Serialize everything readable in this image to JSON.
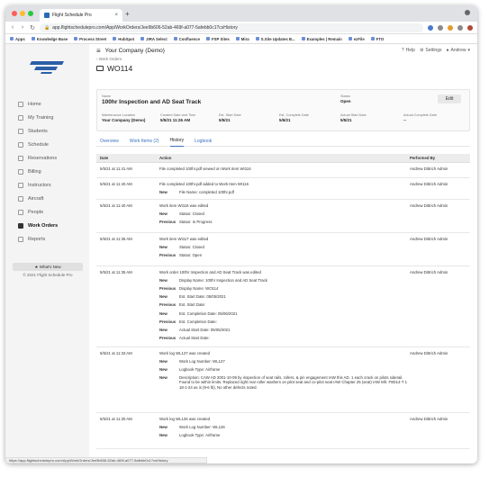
{
  "browser": {
    "tab_title": "Flight Schedule Pro",
    "url": "app.flightschedulepro.com/App/WorkOrders/Jee9b606-52ab-469f-a077-5afebb0c1?csHistory",
    "bookmarks": [
      "Apps",
      "Knowledge Base",
      "Process Street",
      "HubSpot",
      "JIRA Select",
      "Confluence",
      "FSP Sites",
      "Mira",
      "S.Site Updates B...",
      "Examples | Remain",
      "ezFile",
      "FTO"
    ]
  },
  "app": {
    "org_name": "Your Company (Demo)",
    "help": "Help",
    "settings": "Settings",
    "user": "Andrew"
  },
  "sidebar": {
    "items": [
      {
        "label": "Home"
      },
      {
        "label": "My Training"
      },
      {
        "label": "Students"
      },
      {
        "label": "Schedule"
      },
      {
        "label": "Reservations"
      },
      {
        "label": "Billing"
      },
      {
        "label": "Instructors"
      },
      {
        "label": "Aircraft"
      },
      {
        "label": "People"
      },
      {
        "label": "Work Orders"
      },
      {
        "label": "Reports"
      }
    ],
    "whats_new": "★ What's New",
    "copyright": "© 2021 Flight Schedule Pro"
  },
  "page": {
    "breadcrumb": "‹ Work Orders",
    "title": "WO114"
  },
  "card": {
    "name_label": "Name",
    "name_value": "100hr Inspection and AD Seat Track",
    "status_label": "Status",
    "status_value": "Open",
    "edit_label": "Edit",
    "fields": [
      {
        "label": "Maintenance Location",
        "value": "Your Company (Demo)"
      },
      {
        "label": "Created Date and Time",
        "value": "5/5/21 11:26 AM"
      },
      {
        "label": "Est. Start Date",
        "value": "5/5/21"
      },
      {
        "label": "Est. Complete Date",
        "value": "5/6/21"
      },
      {
        "label": "Actual Start Date",
        "value": "5/5/21"
      },
      {
        "label": "Actual Complete Date",
        "value": "--"
      }
    ]
  },
  "tabs": [
    "Overview",
    "Work Items (2)",
    "History",
    "Logbook"
  ],
  "history": {
    "headers": {
      "date": "Date",
      "action": "Action",
      "by": "Performed By"
    },
    "rows": [
      {
        "date": "5/5/21 at 11:41 AM",
        "action": "File completed 100hr.pdf viewed on Work Item WI116",
        "by": "Andrew Dittrich Admin",
        "subs": []
      },
      {
        "date": "5/5/21 at 11:40 AM",
        "action": "File completed 100hr.pdf added to Work Item WI116",
        "by": "Andrew Dittrich Admin",
        "subs": [
          {
            "k": "New",
            "v": "File Name: completed 100hr.pdf"
          }
        ]
      },
      {
        "date": "5/5/21 at 11:40 AM",
        "action": "Work item WI116 was edited",
        "by": "Andrew Dittrich Admin",
        "subs": [
          {
            "k": "New",
            "v": "Status: Closed"
          },
          {
            "k": "Previous",
            "v": "Status: In Progress"
          }
        ]
      },
      {
        "date": "5/5/21 at 11:36 AM",
        "action": "Work item WI117 was edited",
        "by": "Andrew Dittrich Admin",
        "subs": [
          {
            "k": "New",
            "v": "Status: Closed"
          },
          {
            "k": "Previous",
            "v": "Status: Open"
          }
        ]
      },
      {
        "date": "5/5/21 at 11:35 AM",
        "action": "Work order 100hr Inspection and AD Seat Track was edited",
        "by": "Andrew Dittrich Admin",
        "subs": [
          {
            "k": "New",
            "v": "Display Name: 100hr Inspection and AD Seat Track"
          },
          {
            "k": "Previous",
            "v": "Display Name: WO114"
          },
          {
            "k": "New",
            "v": "Est. Start Date: 05/05/2021"
          },
          {
            "k": "Previous",
            "v": "Est. Start Date:"
          },
          {
            "k": "New",
            "v": "Est. Completion Date: 05/06/2021"
          },
          {
            "k": "Previous",
            "v": "Est. Completion Date:"
          },
          {
            "k": "New",
            "v": "Actual Start Date: 05/05/2021"
          },
          {
            "k": "Previous",
            "v": "Actual Start Date:"
          }
        ]
      },
      {
        "date": "5/5/21 at 11:33 AM",
        "action": "Work log WL127 was created",
        "by": "Andrew Dittrich Admin",
        "subs": [
          {
            "k": "New",
            "v": "Work Log Number: WL127"
          },
          {
            "k": "New",
            "v": "Logbook Type: Airframe"
          },
          {
            "k": "New",
            "v": "Description: CAW AD 2001-10-09 by inspection of seat rails, rollers, & pin engagement IAW this AD. 1 each crack on pilots siderail. Found to be within limits. Replaced right rear roller washers on pilot seat and co-pilot seat IAW Chapter 25 (seat) IAW Mfr. F9D14-T 1 18-1-24 as is (9-6 lb), No other defects noted."
          }
        ]
      },
      {
        "date": "5/5/21 at 11:30 AM",
        "action": "Work log WL126 was created",
        "by": "Andrew Dittrich Admin",
        "subs": [
          {
            "k": "New",
            "v": "Work Log Number: WL126"
          },
          {
            "k": "New",
            "v": "Logbook Type: Airframe"
          }
        ]
      }
    ]
  },
  "statusbar": "https://app.flightschedulepro.com/App/WorkOrders/Jee9b606-52ab-469f-a077-5afebb0c1?csHistory"
}
